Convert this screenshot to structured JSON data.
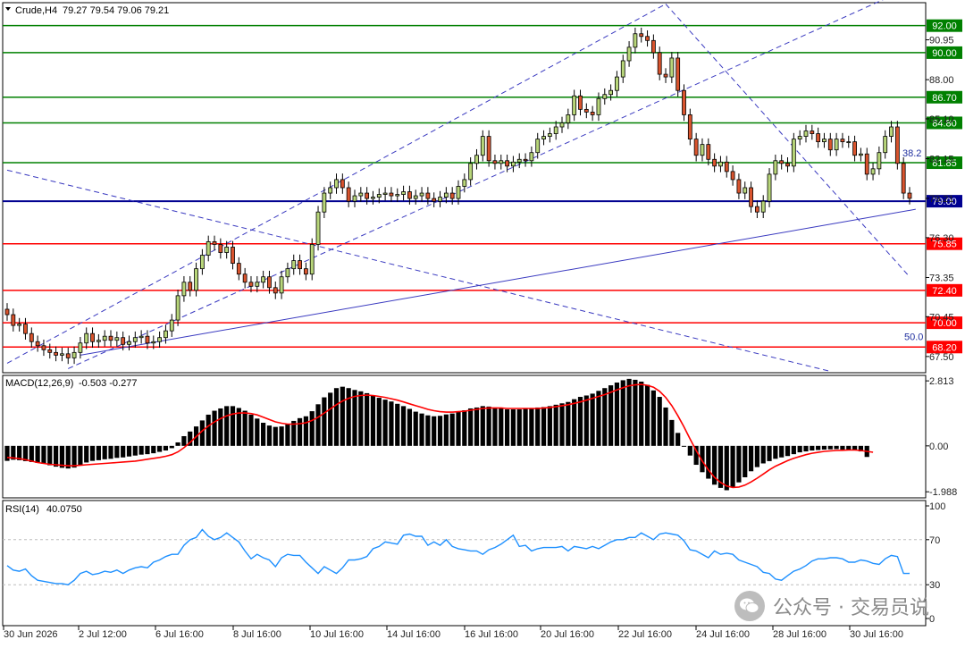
{
  "main_info": {
    "symbol_tf": "Crude,H4",
    "ohlc": "79.27 79.54 79.06 79.21"
  },
  "macd_info": {
    "label": "MACD(12,26,9)",
    "values": "-0.503 -0.277"
  },
  "rsi_info": {
    "label": "RSI(14)",
    "value": "40.0750"
  },
  "watermark": {
    "text": "公众号 · 交易员说"
  },
  "colors": {
    "bull_candle": "#b8d67a",
    "bear_candle": "#d9542e",
    "green_level": "#008000",
    "red_level": "#ff0000",
    "blue_line": "#000090",
    "macd_signal": "#ff0000",
    "rsi_line": "#1e90ff"
  },
  "chart_data": [
    {
      "type": "candlestick",
      "title": "Crude,H4",
      "yticks": [
        "67.50",
        "70.45",
        "73.35",
        "76.30",
        "79.21",
        "82.15",
        "85.10",
        "88.00",
        "90.95"
      ],
      "ylim": [
        66.3,
        93.7
      ],
      "xticks": [
        "30 Jun 2026",
        "2 Jul 12:00",
        "6 Jul 16:00",
        "8 Jul 16:00",
        "10 Jul 16:00",
        "14 Jul 16:00",
        "16 Jul 16:00",
        "20 Jul 16:00",
        "22 Jul 16:00",
        "24 Jul 16:00",
        "28 Jul 16:00",
        "30 Jul 16:00"
      ],
      "levels": [
        {
          "label": "92.00",
          "value": 92.0,
          "color": "green"
        },
        {
          "label": "90.00",
          "value": 90.0,
          "color": "green"
        },
        {
          "label": "86.70",
          "value": 86.7,
          "color": "green"
        },
        {
          "label": "84.80",
          "value": 84.8,
          "color": "green"
        },
        {
          "label": "81.85",
          "value": 81.85,
          "color": "green"
        },
        {
          "label": "79.00",
          "value": 79.0,
          "color": "blue"
        },
        {
          "label": "75.85",
          "value": 75.85,
          "color": "red"
        },
        {
          "label": "72.40",
          "value": 72.4,
          "color": "red"
        },
        {
          "label": "70.00",
          "value": 70.0,
          "color": "red"
        },
        {
          "label": "68.20",
          "value": 68.2,
          "color": "red"
        }
      ],
      "fib_labels": [
        "38.2",
        "50.0"
      ],
      "closes": [
        70.6,
        69.8,
        69.9,
        69.2,
        68.6,
        68.3,
        68.0,
        67.8,
        67.6,
        67.7,
        67.4,
        67.8,
        68.5,
        69.2,
        68.6,
        68.7,
        69.0,
        68.7,
        68.9,
        68.4,
        68.6,
        68.9,
        69.0,
        68.5,
        68.6,
        68.9,
        69.4,
        70.2,
        72.0,
        73.0,
        72.4,
        74.0,
        75.0,
        76.0,
        75.8,
        75.2,
        75.6,
        74.4,
        73.6,
        73.0,
        72.7,
        73.0,
        73.4,
        72.6,
        72.2,
        73.4,
        74.0,
        74.6,
        74.0,
        73.6,
        75.8,
        78.2,
        79.6,
        80.0,
        80.6,
        80.0,
        79.0,
        79.4,
        79.6,
        79.2,
        79.3,
        79.5,
        79.6,
        79.4,
        79.5,
        79.7,
        79.2,
        79.4,
        79.6,
        79.2,
        79.0,
        79.3,
        79.6,
        79.2,
        80.1,
        80.6,
        81.8,
        82.4,
        83.8,
        82.0,
        81.8,
        82.0,
        81.6,
        81.9,
        82.1,
        82.0,
        82.6,
        83.6,
        83.8,
        84.0,
        84.5,
        84.8,
        85.4,
        86.8,
        85.8,
        85.6,
        85.4,
        86.6,
        86.9,
        87.2,
        88.2,
        89.4,
        90.4,
        91.4,
        91.2,
        90.9,
        90.0,
        88.4,
        88.2,
        89.6,
        87.2,
        85.4,
        83.6,
        82.4,
        83.2,
        82.1,
        81.6,
        81.9,
        81.2,
        80.6,
        79.6,
        80.0,
        78.6,
        78.2,
        79.0,
        81.0,
        82.0,
        81.8,
        81.6,
        83.6,
        83.8,
        84.2,
        84.0,
        83.4,
        83.6,
        82.8,
        83.6,
        83.4,
        83.4,
        82.4,
        82.5,
        81.0,
        81.4,
        82.6,
        83.8,
        84.5,
        81.8,
        79.6,
        79.21
      ],
      "candle_count": 149
    },
    {
      "type": "bar",
      "title": "MACD(12,26,9)",
      "yticks": [
        "2.813",
        "0.00",
        "-1.988"
      ],
      "ylim": [
        -2.25,
        3.05
      ],
      "histogram": [
        -0.65,
        -0.6,
        -0.62,
        -0.66,
        -0.7,
        -0.74,
        -0.78,
        -0.84,
        -0.9,
        -0.95,
        -0.98,
        -0.94,
        -0.84,
        -0.72,
        -0.65,
        -0.62,
        -0.58,
        -0.56,
        -0.52,
        -0.5,
        -0.46,
        -0.42,
        -0.38,
        -0.36,
        -0.32,
        -0.26,
        -0.2,
        -0.1,
        0.15,
        0.42,
        0.62,
        0.84,
        1.1,
        1.35,
        1.52,
        1.62,
        1.72,
        1.72,
        1.64,
        1.52,
        1.35,
        1.18,
        1.0,
        0.88,
        0.82,
        0.84,
        0.94,
        1.08,
        1.2,
        1.28,
        1.5,
        1.8,
        2.1,
        2.3,
        2.5,
        2.56,
        2.5,
        2.42,
        2.36,
        2.28,
        2.18,
        2.08,
        2.0,
        1.92,
        1.82,
        1.72,
        1.6,
        1.48,
        1.4,
        1.32,
        1.28,
        1.3,
        1.36,
        1.4,
        1.48,
        1.54,
        1.62,
        1.66,
        1.72,
        1.7,
        1.66,
        1.62,
        1.58,
        1.58,
        1.58,
        1.6,
        1.62,
        1.66,
        1.68,
        1.72,
        1.78,
        1.84,
        1.9,
        2.02,
        2.12,
        2.18,
        2.26,
        2.38,
        2.5,
        2.62,
        2.74,
        2.84,
        2.9,
        2.86,
        2.78,
        2.64,
        2.4,
        2.12,
        1.66,
        1.12,
        0.56,
        0.0,
        -0.42,
        -0.82,
        -1.14,
        -1.42,
        -1.68,
        -1.82,
        -1.92,
        -1.8,
        -1.58,
        -1.36,
        -1.1,
        -0.92,
        -0.76,
        -0.66,
        -0.56,
        -0.5,
        -0.44,
        -0.36,
        -0.28,
        -0.24,
        -0.2,
        -0.18,
        -0.16,
        -0.15,
        -0.14,
        -0.16,
        -0.18,
        -0.2,
        -0.24,
        -0.48
      ],
      "signal": [
        -0.5,
        -0.52,
        -0.55,
        -0.6,
        -0.66,
        -0.72,
        -0.76,
        -0.8,
        -0.82,
        -0.84,
        -0.86,
        -0.86,
        -0.84,
        -0.82,
        -0.8,
        -0.78,
        -0.76,
        -0.74,
        -0.72,
        -0.7,
        -0.68,
        -0.66,
        -0.62,
        -0.58,
        -0.54,
        -0.5,
        -0.45,
        -0.38,
        -0.26,
        -0.08,
        0.15,
        0.4,
        0.65,
        0.86,
        1.04,
        1.18,
        1.3,
        1.38,
        1.42,
        1.42,
        1.4,
        1.34,
        1.24,
        1.14,
        1.04,
        0.98,
        0.94,
        0.94,
        0.96,
        1.0,
        1.1,
        1.24,
        1.42,
        1.6,
        1.78,
        1.94,
        2.06,
        2.14,
        2.18,
        2.2,
        2.18,
        2.14,
        2.1,
        2.04,
        1.98,
        1.9,
        1.82,
        1.74,
        1.66,
        1.58,
        1.52,
        1.48,
        1.46,
        1.46,
        1.48,
        1.5,
        1.54,
        1.58,
        1.62,
        1.64,
        1.64,
        1.64,
        1.62,
        1.62,
        1.62,
        1.62,
        1.62,
        1.62,
        1.64,
        1.66,
        1.7,
        1.74,
        1.78,
        1.84,
        1.9,
        1.98,
        2.06,
        2.14,
        2.22,
        2.32,
        2.42,
        2.52,
        2.6,
        2.64,
        2.66,
        2.62,
        2.54,
        2.36,
        2.1,
        1.74,
        1.3,
        0.82,
        0.3,
        -0.2,
        -0.66,
        -1.04,
        -1.36,
        -1.58,
        -1.74,
        -1.8,
        -1.78,
        -1.7,
        -1.56,
        -1.4,
        -1.22,
        -1.04,
        -0.88,
        -0.76,
        -0.64,
        -0.54,
        -0.46,
        -0.38,
        -0.32,
        -0.28,
        -0.24,
        -0.22,
        -0.2,
        -0.19,
        -0.18,
        -0.18,
        -0.2,
        -0.24,
        -0.277
      ]
    },
    {
      "type": "line",
      "title": "RSI(14)",
      "yticks": [
        "100",
        "70",
        "30",
        "0"
      ],
      "ylim": [
        0,
        100
      ],
      "levels": [
        70,
        30
      ],
      "values": [
        47,
        43,
        42,
        44,
        38,
        34,
        33,
        32,
        31,
        31,
        30,
        34,
        40,
        42,
        39,
        40,
        42,
        41,
        43,
        40,
        43,
        45,
        46,
        45,
        50,
        52,
        55,
        57,
        57,
        65,
        70,
        72,
        79,
        73,
        70,
        72,
        76,
        72,
        68,
        60,
        53,
        57,
        54,
        52,
        46,
        54,
        57,
        56,
        56,
        50,
        45,
        40,
        46,
        43,
        40,
        45,
        52,
        52,
        53,
        55,
        62,
        64,
        68,
        67,
        66,
        74,
        75,
        73,
        73,
        65,
        68,
        65,
        70,
        64,
        62,
        61,
        60,
        60,
        57,
        61,
        63,
        66,
        70,
        74,
        64,
        65,
        60,
        62,
        63,
        63,
        63,
        64,
        60,
        64,
        63,
        62,
        64,
        62,
        65,
        68,
        70,
        70,
        72,
        72,
        76,
        73,
        70,
        75,
        76,
        75,
        74,
        69,
        61,
        60,
        57,
        54,
        60,
        57,
        58,
        57,
        52,
        50,
        48,
        46,
        41,
        40,
        35,
        34,
        38,
        42,
        44,
        47,
        51,
        53,
        53,
        54,
        54,
        53,
        50,
        50,
        52,
        51,
        49,
        48,
        53,
        56,
        55,
        40,
        40.075
      ]
    }
  ]
}
